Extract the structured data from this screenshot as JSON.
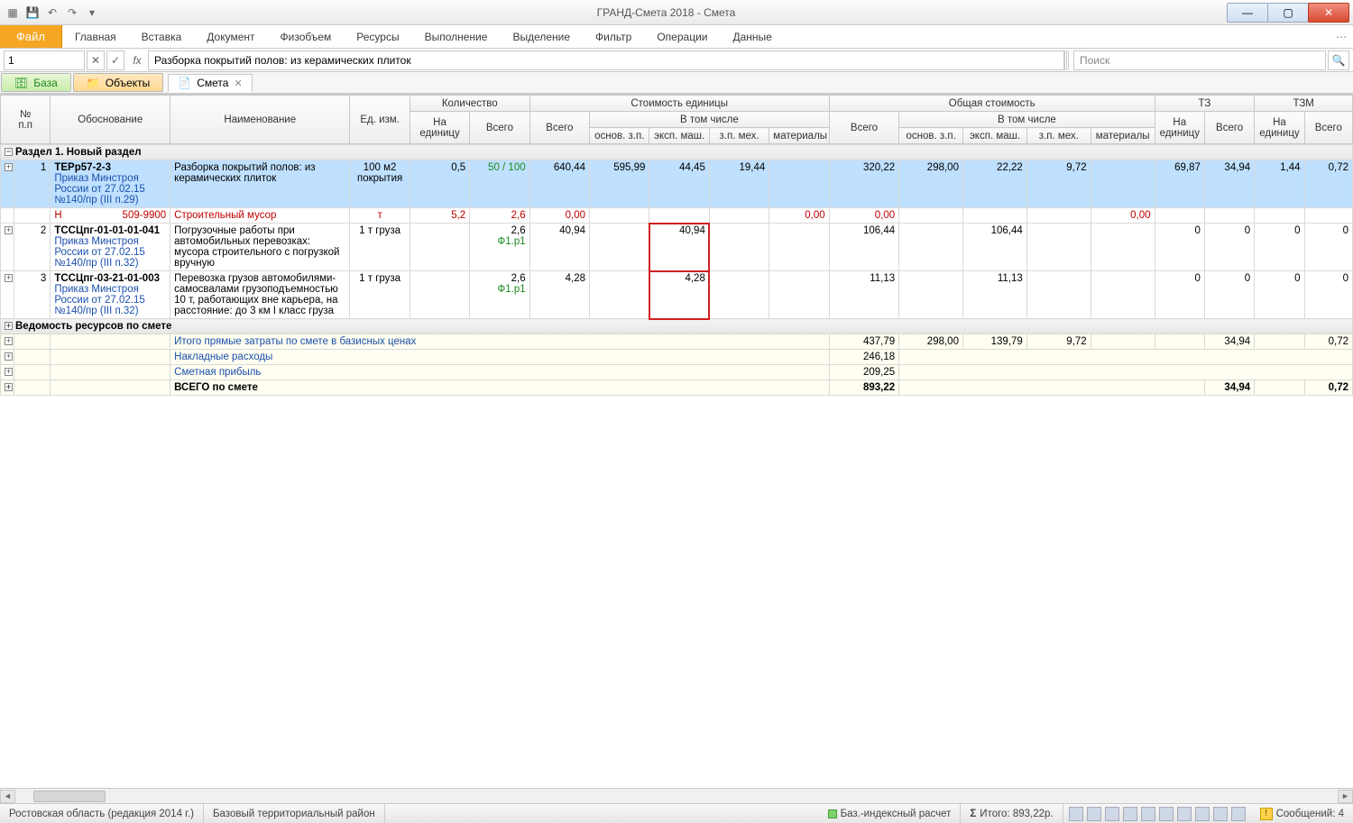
{
  "window": {
    "title": "ГРАНД-Смета 2018 - Смета"
  },
  "ribbon": {
    "file": "Файл",
    "tabs": [
      "Главная",
      "Вставка",
      "Документ",
      "Физобъем",
      "Ресурсы",
      "Выполнение",
      "Выделение",
      "Фильтр",
      "Операции",
      "Данные"
    ]
  },
  "formula_bar": {
    "cell_ref": "1",
    "fx": "fx",
    "formula": "Разборка покрытий полов: из керамических плиток",
    "search_placeholder": "Поиск"
  },
  "nav": {
    "base": "База",
    "objects": "Объекты",
    "tab": "Смета"
  },
  "headers": {
    "num": "№\nп.п",
    "basis": "Обоснование",
    "name": "Наименование",
    "unit": "Ед. изм.",
    "qty": "Количество",
    "qty_unit": "На\nединицу",
    "qty_total": "Всего",
    "cost_unit": "Стоимость единицы",
    "total": "Всего",
    "incl": "В том числе",
    "osn": "основ. з.п.",
    "ekspm": "эксп. маш.",
    "zpmex": "з.п. мех.",
    "mat": "материалы",
    "cost_total": "Общая стоимость",
    "tz": "ТЗ",
    "tzm": "ТЗМ"
  },
  "section": "Раздел 1. Новый раздел",
  "rows": [
    {
      "n": "1",
      "code": "ТЕРр57-2-3",
      "order": "Приказ Минстроя России от 27.02.15 №140/пр (III п.29)",
      "name": "Разборка покрытий полов: из керамических плиток",
      "unit": "100 м2 покрытия",
      "qty_u": "0,5",
      "qty_t": "50 / 100",
      "cost_t": "640,44",
      "c1": "595,99",
      "c2": "44,45",
      "c3": "19,44",
      "c4": "",
      "tot_t": "320,22",
      "t1": "298,00",
      "t2": "22,22",
      "t3": "9,72",
      "t4": "",
      "tz_u": "69,87",
      "tz_t": "34,94",
      "tzm_u": "1,44",
      "tzm_t": "0,72",
      "selected": true
    },
    {
      "n": "",
      "code": "Н",
      "order": "509-9900",
      "name": "Строительный мусор",
      "unit": "т",
      "qty_u": "5,2",
      "qty_t": "2,6",
      "cost_t": "0,00",
      "c1": "",
      "c2": "",
      "c3": "",
      "c4": "0,00",
      "tot_t": "0,00",
      "t1": "",
      "t2": "",
      "t3": "",
      "t4": "0,00",
      "tz_u": "",
      "tz_t": "",
      "tzm_u": "",
      "tzm_t": "",
      "red": true
    },
    {
      "n": "2",
      "code": "ТССЦпг-01-01-01-041",
      "order": "Приказ Минстроя России от 27.02.15 №140/пр (III п.32)",
      "name": "Погрузочные работы при автомобильных перевозках: мусора строительного с погрузкой вручную",
      "unit": "1 т груза",
      "qty_u": "",
      "qty_t": "2,6",
      "qty_note": "Ф1.р1",
      "cost_t": "40,94",
      "c1": "",
      "c2": "40,94",
      "c3": "",
      "c4": "",
      "tot_t": "106,44",
      "t1": "",
      "t2": "106,44",
      "t3": "",
      "t4": "",
      "tz_u": "0",
      "tz_t": "0",
      "tzm_u": "0",
      "tzm_t": "0",
      "mark": true
    },
    {
      "n": "3",
      "code": "ТССЦпг-03-21-01-003",
      "order": "Приказ Минстроя России от 27.02.15 №140/пр (III п.32)",
      "name": "Перевозка грузов автомобилями-самосвалами грузоподъемностью 10 т, работающих вне карьера, на расстояние: до 3 км I класс груза",
      "unit": "1 т груза",
      "qty_u": "",
      "qty_t": "2,6",
      "qty_note": "Ф1.р1",
      "cost_t": "4,28",
      "c1": "",
      "c2": "4,28",
      "c3": "",
      "c4": "",
      "tot_t": "11,13",
      "t1": "",
      "t2": "11,13",
      "t3": "",
      "t4": "",
      "tz_u": "0",
      "tz_t": "0",
      "tzm_u": "0",
      "tzm_t": "0",
      "mark": true
    }
  ],
  "resources_section": "Ведомость ресурсов по смете",
  "summary": [
    {
      "label": "Итого прямые затраты по смете в базисных ценах",
      "tot": "437,79",
      "t1": "298,00",
      "t2": "139,79",
      "t3": "9,72",
      "t4": "",
      "tz": "34,94",
      "tzm": "0,72"
    },
    {
      "label": "Накладные расходы",
      "tot": "246,18"
    },
    {
      "label": "Сметная прибыль",
      "tot": "209,25"
    }
  ],
  "grand_total": {
    "label": "ВСЕГО по смете",
    "tot": "893,22",
    "tz": "34,94",
    "tzm": "0,72"
  },
  "status": {
    "region": "Ростовская область (редакция 2014 г.)",
    "district": "Базовый территориальный район",
    "mode": "Баз.-индексный расчет",
    "total": "Итого: 893,22р.",
    "messages": "Сообщений: 4"
  }
}
